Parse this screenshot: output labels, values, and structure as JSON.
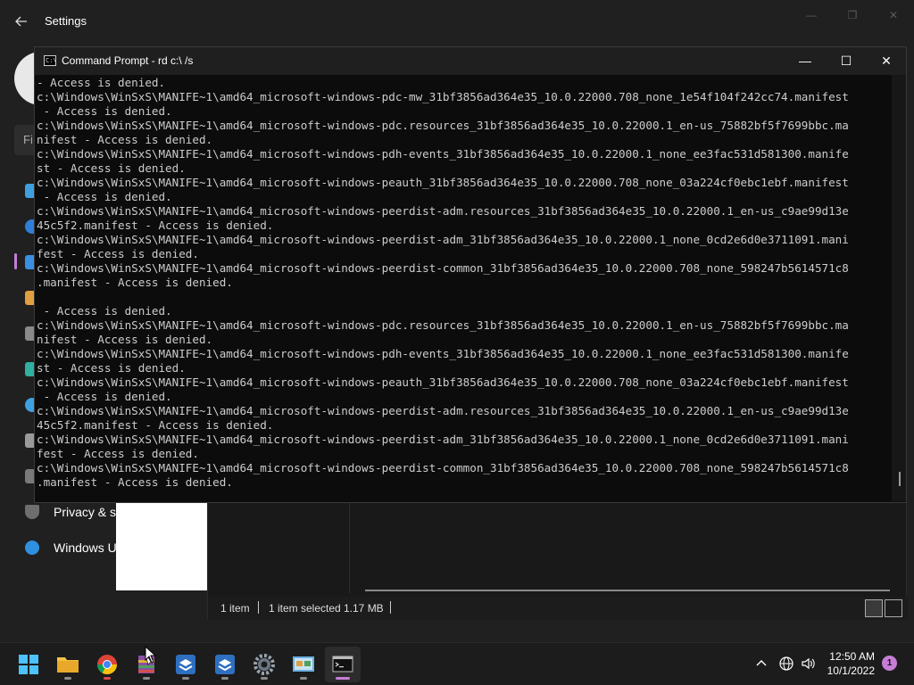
{
  "settings": {
    "title": "Settings",
    "search_partial": "Fi",
    "nav_privacy": "Privacy & s",
    "nav_windows_update": "Windows U",
    "window_controls": [
      "—",
      "❐",
      "✕"
    ]
  },
  "explorer": {
    "status": {
      "items": "1 item",
      "selected": "1 item selected",
      "size": "1.17 MB"
    }
  },
  "cmd": {
    "title": "Command Prompt - rd  c:\\ /s",
    "icon_text": "C:\\",
    "controls": [
      "—",
      "☐",
      "✕"
    ],
    "lines": [
      "- Access is denied.",
      "c:\\Windows\\WinSxS\\MANIFE~1\\amd64_microsoft-windows-pdc-mw_31bf3856ad364e35_10.0.22000.708_none_1e54f104f242cc74.manifest",
      " - Access is denied.",
      "c:\\Windows\\WinSxS\\MANIFE~1\\amd64_microsoft-windows-pdc.resources_31bf3856ad364e35_10.0.22000.1_en-us_75882bf5f7699bbc.ma",
      "nifest - Access is denied.",
      "c:\\Windows\\WinSxS\\MANIFE~1\\amd64_microsoft-windows-pdh-events_31bf3856ad364e35_10.0.22000.1_none_ee3fac531d581300.manife",
      "st - Access is denied.",
      "c:\\Windows\\WinSxS\\MANIFE~1\\amd64_microsoft-windows-peauth_31bf3856ad364e35_10.0.22000.708_none_03a224cf0ebc1ebf.manifest",
      " - Access is denied.",
      "c:\\Windows\\WinSxS\\MANIFE~1\\amd64_microsoft-windows-peerdist-adm.resources_31bf3856ad364e35_10.0.22000.1_en-us_c9ae99d13e",
      "45c5f2.manifest - Access is denied.",
      "c:\\Windows\\WinSxS\\MANIFE~1\\amd64_microsoft-windows-peerdist-adm_31bf3856ad364e35_10.0.22000.1_none_0cd2e6d0e3711091.mani",
      "fest - Access is denied.",
      "c:\\Windows\\WinSxS\\MANIFE~1\\amd64_microsoft-windows-peerdist-common_31bf3856ad364e35_10.0.22000.708_none_598247b5614571c8",
      ".manifest - Access is denied.",
      "",
      " - Access is denied.",
      "c:\\Windows\\WinSxS\\MANIFE~1\\amd64_microsoft-windows-pdc.resources_31bf3856ad364e35_10.0.22000.1_en-us_75882bf5f7699bbc.ma",
      "nifest - Access is denied.",
      "c:\\Windows\\WinSxS\\MANIFE~1\\amd64_microsoft-windows-pdh-events_31bf3856ad364e35_10.0.22000.1_none_ee3fac531d581300.manife",
      "st - Access is denied.",
      "c:\\Windows\\WinSxS\\MANIFE~1\\amd64_microsoft-windows-peauth_31bf3856ad364e35_10.0.22000.708_none_03a224cf0ebc1ebf.manifest",
      " - Access is denied.",
      "c:\\Windows\\WinSxS\\MANIFE~1\\amd64_microsoft-windows-peerdist-adm.resources_31bf3856ad364e35_10.0.22000.1_en-us_c9ae99d13e",
      "45c5f2.manifest - Access is denied.",
      "c:\\Windows\\WinSxS\\MANIFE~1\\amd64_microsoft-windows-peerdist-adm_31bf3856ad364e35_10.0.22000.1_none_0cd2e6d0e3711091.mani",
      "fest - Access is denied.",
      "c:\\Windows\\WinSxS\\MANIFE~1\\amd64_microsoft-windows-peerdist-common_31bf3856ad364e35_10.0.22000.708_none_598247b5614571c8",
      ".manifest - Access is denied."
    ]
  },
  "taskbar": {
    "apps": [
      "start-icon",
      "file-explorer-icon",
      "chrome-icon",
      "winrar-icon",
      "virtualbox-icon",
      "virtualbox-icon",
      "settings-icon",
      "control-panel-icon",
      "command-prompt-icon"
    ],
    "time": "12:50 AM",
    "date": "10/1/2022",
    "notification_count": "1"
  },
  "colors": {
    "accent": "#c77dd6",
    "console_text": "#cccccc",
    "console_bg": "#0c0c0c"
  }
}
